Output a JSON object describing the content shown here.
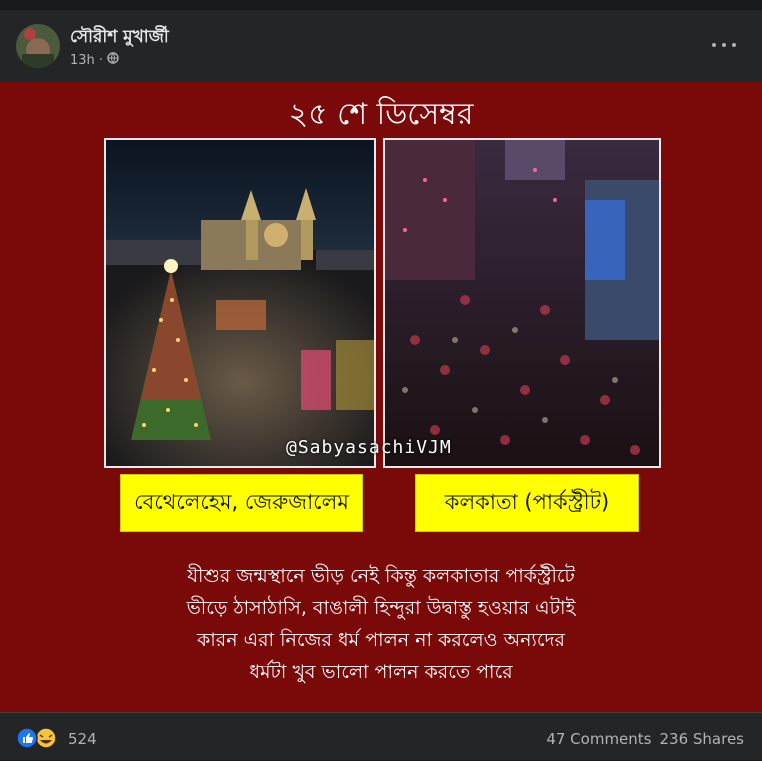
{
  "post": {
    "author": "সৌরীশ মুখার্জী",
    "time": "13h",
    "separator": "·"
  },
  "image": {
    "title": "২৫ শে ডিসেম্বর",
    "watermark": "@SabyasachiVJM",
    "left_label": "বেথেলেহেম, জেরুজালেম",
    "right_label": "কলকাতা (পার্কস্ট্রীট)",
    "caption": [
      "যীশুর জন্মস্থানে ভীড় নেই কিন্তু কলকাতার পার্কস্ট্রীটে",
      "ভীড়ে ঠাসাঠাসি, বাঙালী হিন্দুরা উদ্বাস্তু হওয়ার এটাই",
      "কারন এরা নিজের ধর্ম পালন না করলেও অন্যদের",
      "ধর্মটা খুব ভালো পালন করতে পারে"
    ]
  },
  "footer": {
    "reaction_count": "524",
    "comments": "47 Comments",
    "shares": "236 Shares"
  },
  "colors": {
    "background": "#242526",
    "image_bg": "#7a0a0a",
    "label_bg": "#ffff00",
    "like_blue": "#1877f2",
    "haha_yellow": "#f7c33b"
  }
}
